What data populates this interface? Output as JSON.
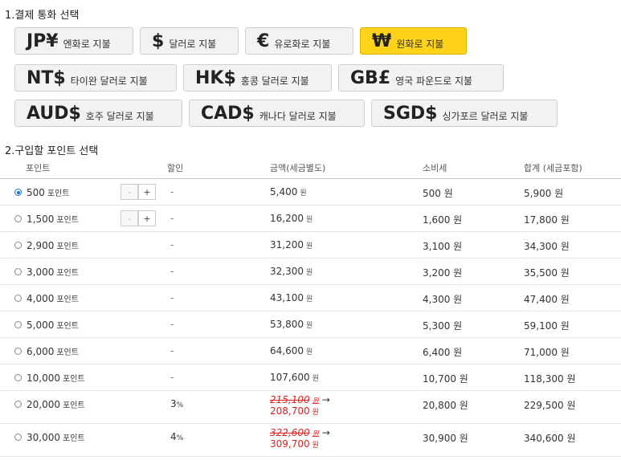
{
  "section1_title": "1.결제 통화 선택",
  "section2_title": "2.구입할 포인트 선택",
  "currencies": [
    {
      "symbol": "JP¥",
      "label": "엔화로 지불"
    },
    {
      "symbol": "$",
      "label": "달러로 지불"
    },
    {
      "symbol": "€",
      "label": "유로화로 지불"
    },
    {
      "symbol": "₩",
      "label": "원화로 지불",
      "active": true
    },
    {
      "symbol": "NT$",
      "label": "타이완 달러로 지불"
    },
    {
      "symbol": "HK$",
      "label": "홍콩 달러로 지불"
    },
    {
      "symbol": "GB£",
      "label": "영국 파운드로 지불"
    },
    {
      "symbol": "AUD$",
      "label": "호주 달러로 지불"
    },
    {
      "symbol": "CAD$",
      "label": "캐나다 달러로 지불"
    },
    {
      "symbol": "SGD$",
      "label": "싱가포르 달러로 지불"
    }
  ],
  "table": {
    "headers": {
      "points": "포인트",
      "discount": "할인",
      "amount": "금액(세금별도)",
      "tax": "소비세",
      "total": "합계 (세금포함)"
    },
    "point_unit": "포인트",
    "won_unit": "원",
    "stepper": {
      "minus": "-",
      "plus": "+"
    },
    "arrow": "→",
    "dash": "-",
    "rows": [
      {
        "points": "500",
        "discount": "-",
        "amount": "5,400",
        "tax": "500 원",
        "total": "5,900 원",
        "checked": true,
        "stepper": true
      },
      {
        "points": "1,500",
        "discount": "-",
        "amount": "16,200",
        "tax": "1,600 원",
        "total": "17,800 원",
        "stepper": true
      },
      {
        "points": "2,900",
        "discount": "-",
        "amount": "31,200",
        "tax": "3,100 원",
        "total": "34,300 원"
      },
      {
        "points": "3,000",
        "discount": "-",
        "amount": "32,300",
        "tax": "3,200 원",
        "total": "35,500 원"
      },
      {
        "points": "4,000",
        "discount": "-",
        "amount": "43,100",
        "tax": "4,300 원",
        "total": "47,400 원"
      },
      {
        "points": "5,000",
        "discount": "-",
        "amount": "53,800",
        "tax": "5,300 원",
        "total": "59,100 원"
      },
      {
        "points": "6,000",
        "discount": "-",
        "amount": "64,600",
        "tax": "6,400 원",
        "total": "71,000 원"
      },
      {
        "points": "10,000",
        "discount": "-",
        "amount": "107,600",
        "tax": "10,700 원",
        "total": "118,300 원"
      },
      {
        "points": "20,000",
        "discount": "3",
        "discount_unit": "%",
        "amount_original": "215,100",
        "amount": "208,700",
        "tax": "20,800 원",
        "total": "229,500 원"
      },
      {
        "points": "30,000",
        "discount": "4",
        "discount_unit": "%",
        "amount_original": "322,600",
        "amount": "309,700",
        "tax": "30,900 원",
        "total": "340,600 원"
      }
    ]
  }
}
